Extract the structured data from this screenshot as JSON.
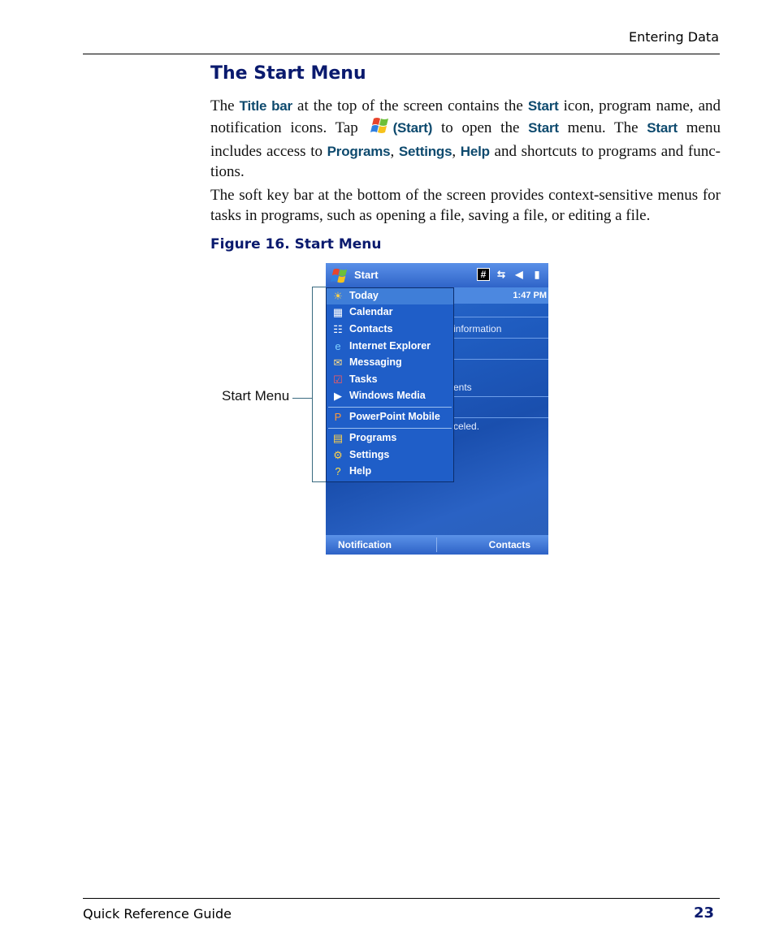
{
  "header": {
    "section": "Entering Data"
  },
  "section_title": "The Start Menu",
  "para1": {
    "t1": "The ",
    "ui_title_bar": "Title bar",
    "t2": " at the top of the screen contains the ",
    "ui_start1": "Start",
    "t3": " icon, program name, and notification icons. Tap ",
    "ui_start_paren": "(Start)",
    "t4": " to open the ",
    "ui_start2": "Start",
    "t5": " menu. The ",
    "ui_start3": "Start",
    "t6": " menu includes access to ",
    "ui_programs": "Programs",
    "c1": ", ",
    "ui_settings": "Settings",
    "c2": ", ",
    "ui_help": "Help",
    "t7": " and shortcuts to programs and func-tions."
  },
  "para2": "The soft key bar at the bottom of the screen provides context-sensitive menus for tasks in programs, such as opening a file, saving a file, or editing a file.",
  "figure_caption": "Figure 16. Start Menu",
  "callout": "Start Menu",
  "device": {
    "title": "Start",
    "time": "1:47 PM",
    "bg_texts": [
      "information",
      "ents",
      "celed."
    ],
    "menu_items": [
      {
        "label": "Today",
        "icon": "today-icon",
        "glyph": "☀",
        "color": "#ffd24a"
      },
      {
        "label": "Calendar",
        "icon": "calendar-icon",
        "glyph": "▦",
        "color": "#ffffff"
      },
      {
        "label": "Contacts",
        "icon": "contacts-icon",
        "glyph": "☷",
        "color": "#ffffff"
      },
      {
        "label": "Internet Explorer",
        "icon": "internet-explorer-icon",
        "glyph": "e",
        "color": "#7fd0ff"
      },
      {
        "label": "Messaging",
        "icon": "messaging-icon",
        "glyph": "✉",
        "color": "#ffe08a"
      },
      {
        "label": "Tasks",
        "icon": "tasks-icon",
        "glyph": "☑",
        "color": "#ff5a5a"
      },
      {
        "label": "Windows Media",
        "icon": "windows-media-icon",
        "glyph": "▶",
        "color": "#ffffff"
      },
      {
        "label": "PowerPoint Mobile",
        "icon": "powerpoint-icon",
        "glyph": "P",
        "color": "#ff9a3a"
      },
      {
        "label": "Programs",
        "icon": "programs-folder-icon",
        "glyph": "▤",
        "color": "#ffd24a"
      },
      {
        "label": "Settings",
        "icon": "settings-folder-icon",
        "glyph": "⚙",
        "color": "#ffd24a"
      },
      {
        "label": "Help",
        "icon": "help-icon",
        "glyph": "?",
        "color": "#ffe04a"
      }
    ],
    "soft_left": "Notification",
    "soft_right": "Contacts"
  },
  "footer": {
    "left": "Quick Reference Guide",
    "page": "23"
  }
}
